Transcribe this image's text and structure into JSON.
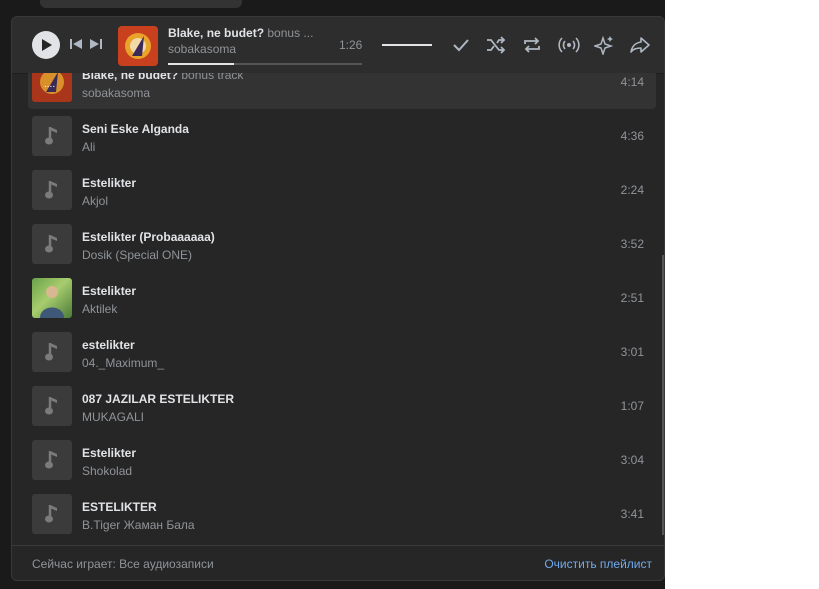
{
  "player": {
    "title": "Blake, ne budet?",
    "subtitle": "bonus ...",
    "artist": "sobakasoma",
    "time": "1:26",
    "progress_fraction": 0.34,
    "volume_fraction": 1.0,
    "icons": [
      "play-icon",
      "previous-icon",
      "next-icon",
      "add-check-icon",
      "shuffle-icon",
      "repeat-icon",
      "broadcast-icon",
      "recommendations-icon",
      "share-icon"
    ]
  },
  "tracks": [
    {
      "title": "Blake, ne budet?",
      "subtitle": "bonus track",
      "artist": "sobakasoma",
      "duration": "4:14",
      "active": true,
      "thumb": "cover"
    },
    {
      "title": "Seni Eske Alganda",
      "subtitle": "",
      "artist": "Ali",
      "duration": "4:36",
      "thumb": "note"
    },
    {
      "title": "Estelikter",
      "subtitle": "",
      "artist": "Akjol",
      "duration": "2:24",
      "thumb": "note"
    },
    {
      "title": "Estelikter (Probaaaaaa)",
      "subtitle": "",
      "artist": "Dosik (Special ONE)",
      "duration": "3:52",
      "thumb": "note"
    },
    {
      "title": "Estelikter",
      "subtitle": "",
      "artist": "Aktilek",
      "duration": "2:51",
      "thumb": "photo"
    },
    {
      "title": "estelikter",
      "subtitle": "",
      "artist": "04._Maximum_",
      "duration": "3:01",
      "thumb": "note"
    },
    {
      "title": "087 JAZILAR ESTELIKTER",
      "subtitle": "",
      "artist": "MUKAGALI",
      "duration": "1:07",
      "thumb": "note"
    },
    {
      "title": "Estelikter",
      "subtitle": "",
      "artist": "Shokolad",
      "duration": "3:04",
      "thumb": "note"
    },
    {
      "title": "ESTELIKTER",
      "subtitle": "",
      "artist": "B.Tiger Жаман Бала",
      "duration": "3:41",
      "thumb": "note"
    }
  ],
  "footer": {
    "now_playing": "Сейчас играет: Все аудиозаписи",
    "clear_label": "Очистить плейлист"
  },
  "colors": {
    "accent": "#71aaeb",
    "text": "#e1e3e6",
    "secondary": "#909499",
    "panel": "#262626"
  }
}
